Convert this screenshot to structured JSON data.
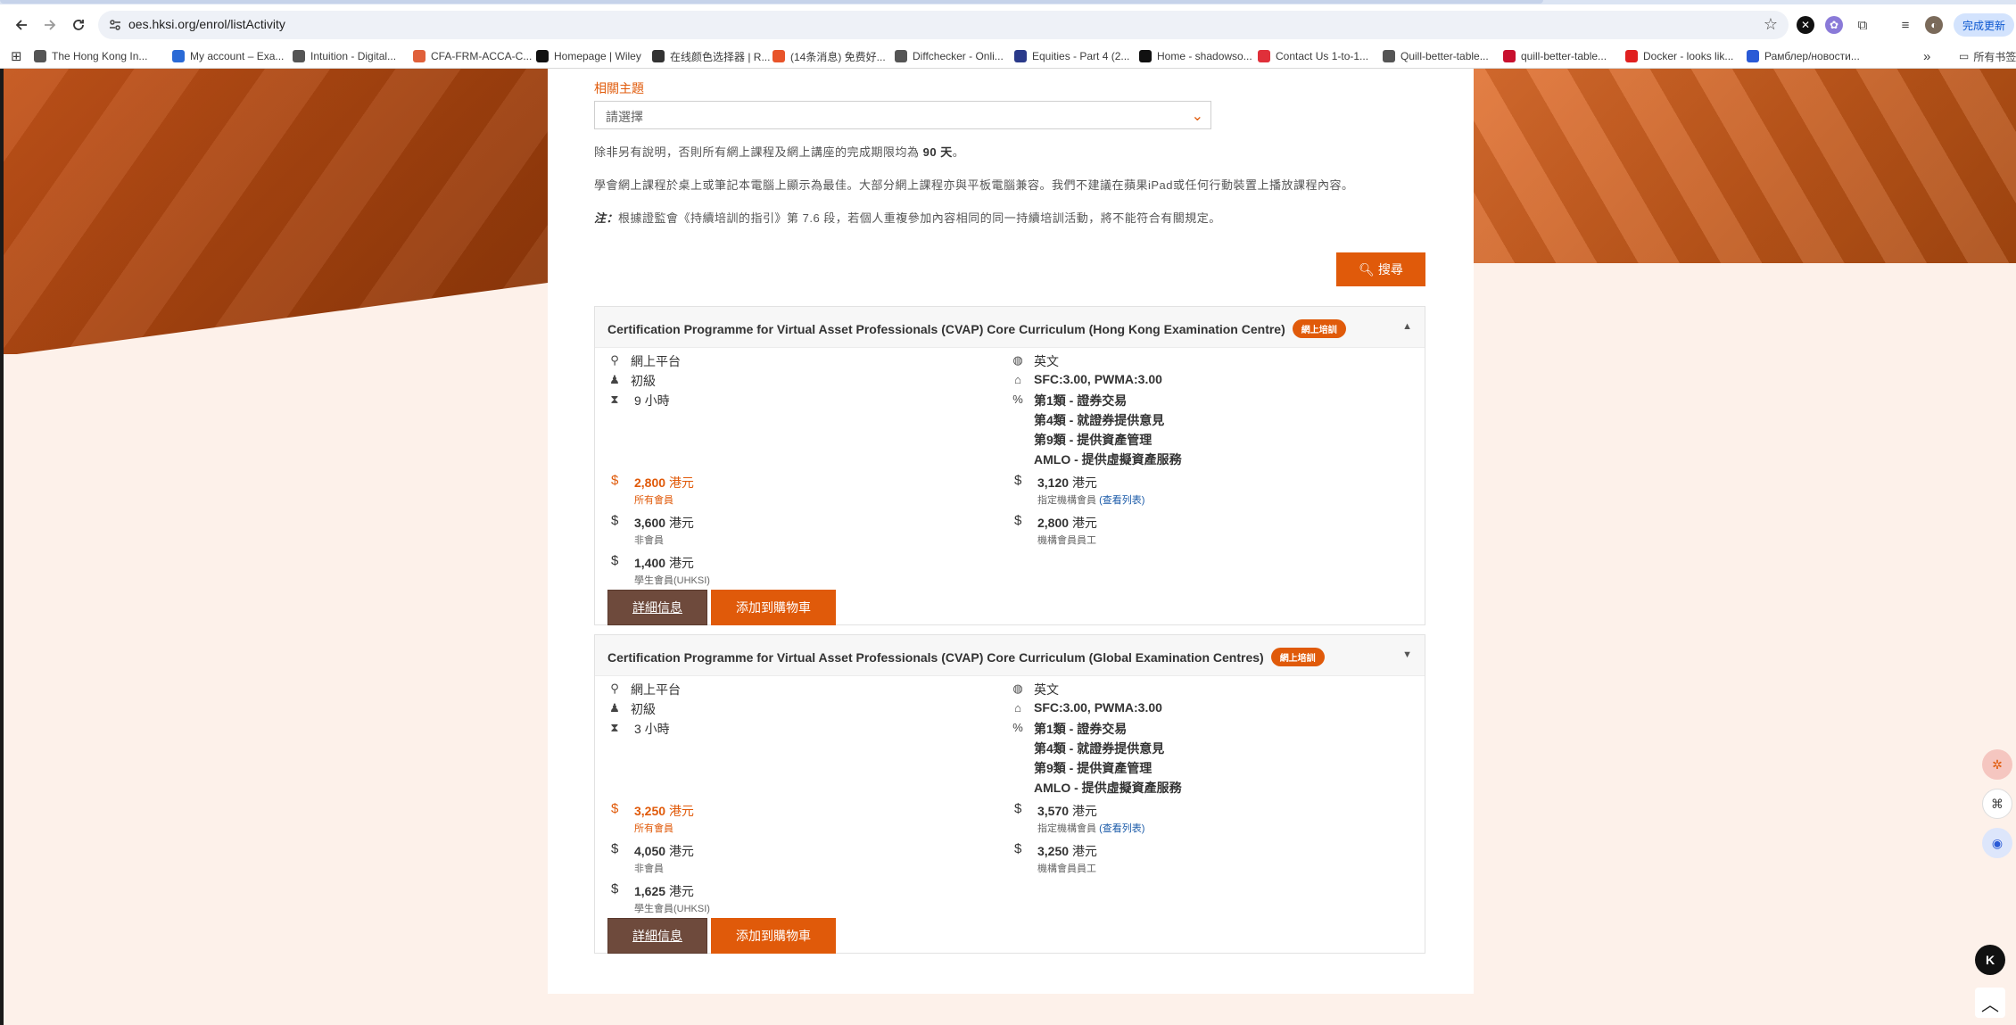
{
  "browser": {
    "url": "oes.hksi.org/enrol/listActivity",
    "update_label": "完成更新",
    "bookmarks": [
      {
        "label": "The Hong Kong In...",
        "color": "#555555",
        "icon": "globe-icon"
      },
      {
        "label": "My account – Exa...",
        "color": "#2a6ad6",
        "icon": "account-icon"
      },
      {
        "label": "Intuition - Digital...",
        "color": "#555555",
        "icon": "globe-icon"
      },
      {
        "label": "CFA-FRM-ACCA-C...",
        "color": "#e0603a",
        "icon": "cfa-icon"
      },
      {
        "label": "Homepage | Wiley",
        "color": "#111111",
        "icon": "wiley-icon"
      },
      {
        "label": "在线颜色选择器 | R...",
        "color": "#333333",
        "icon": "tumblr-icon"
      },
      {
        "label": "(14条消息) 免费好...",
        "color": "#e8542a",
        "icon": "csdn-icon"
      },
      {
        "label": "Diffchecker - Onli...",
        "color": "#555555",
        "icon": "globe-icon"
      },
      {
        "label": "Equities - Part 4 (2...",
        "color": "#2a3a8a",
        "icon": "equities-icon"
      },
      {
        "label": "Home - shadowso...",
        "color": "#111111",
        "icon": "github-icon"
      },
      {
        "label": "Contact Us 1-to-1...",
        "color": "#e0303a",
        "icon": "contact-icon"
      },
      {
        "label": "Quill-better-table...",
        "color": "#555555",
        "icon": "quill-icon"
      },
      {
        "label": "quill-better-table...",
        "color": "#c8102e",
        "icon": "npm-icon"
      },
      {
        "label": "Docker - looks lik...",
        "color": "#e02020",
        "icon": "youtube-icon"
      },
      {
        "label": "Рамблер/новости...",
        "color": "#2a5ad6",
        "icon": "rambler-icon"
      }
    ],
    "more_bookmarks": "»",
    "all_bookmarks": "所有书签"
  },
  "filter": {
    "topic_label": "相關主題",
    "topic_value": "請選擇",
    "note1_pre": "除非另有說明，否則所有網上課程及網上講座的完成期限均為 ",
    "note1_bold": "90 天",
    "note1_post": "。",
    "note2": "學會網上課程於桌上或筆記本電腦上顯示為最佳。大部分網上課程亦與平板電腦兼容。我們不建議在蘋果iPad或任何行動裝置上播放課程內容。",
    "note3_prefix": "注：",
    "note3": "根據證監會《持續培訓的指引》第 7.6 段，若個人重複參加內容相同的同一持續培訓活動，將不能符合有關規定。",
    "search_label": "搜尋"
  },
  "courses": [
    {
      "title": "Certification Programme for Virtual Asset Professionals (CVAP) Core Curriculum (Hong Kong Examination Centre)",
      "badge": "網上培訓",
      "caret": "▲",
      "venue": "網上平台",
      "level": "初級",
      "duration": "9 小時",
      "language": "英文",
      "cpt": "SFC:3.00, PWMA:3.00",
      "categories": [
        "第1類 - 證券交易",
        "第4類 - 就證券提供意見",
        "第9類 - 提供資產管理",
        "AMLO - 提供虛擬資產服務"
      ],
      "prices": {
        "all_members": {
          "amount": "2,800",
          "unit": "港元",
          "label": "所有會員"
        },
        "non_member": {
          "amount": "3,600",
          "unit": "港元",
          "label": "非會員"
        },
        "student": {
          "amount": "1,400",
          "unit": "港元",
          "label": "學生會員(UHKSI)"
        },
        "designated": {
          "amount": "3,120",
          "unit": "港元",
          "label": "指定機構會員",
          "link": "(查看列表)"
        },
        "corporate_staff": {
          "amount": "2,800",
          "unit": "港元",
          "label": "機構會員員工"
        }
      },
      "detail_label": "詳細信息",
      "cart_label": "添加到購物車"
    },
    {
      "title": "Certification Programme for Virtual Asset Professionals (CVAP) Core Curriculum (Global Examination Centres)",
      "badge": "網上培訓",
      "caret": "▼",
      "venue": "網上平台",
      "level": "初級",
      "duration": "3 小時",
      "language": "英文",
      "cpt": "SFC:3.00, PWMA:3.00",
      "categories": [
        "第1類 - 證券交易",
        "第4類 - 就證券提供意見",
        "第9類 - 提供資產管理",
        "AMLO - 提供虛擬資產服務"
      ],
      "prices": {
        "all_members": {
          "amount": "3,250",
          "unit": "港元",
          "label": "所有會員"
        },
        "non_member": {
          "amount": "4,050",
          "unit": "港元",
          "label": "非會員"
        },
        "student": {
          "amount": "1,625",
          "unit": "港元",
          "label": "學生會員(UHKSI)"
        },
        "designated": {
          "amount": "3,570",
          "unit": "港元",
          "label": "指定機構會員",
          "link": "(查看列表)"
        },
        "corporate_staff": {
          "amount": "3,250",
          "unit": "港元",
          "label": "機構會員員工"
        }
      },
      "detail_label": "詳細信息",
      "cart_label": "添加到購物車"
    }
  ],
  "colors": {
    "accent": "#e05a0a",
    "detail_button": "#6e4a3c",
    "link": "#1a5aa8"
  }
}
